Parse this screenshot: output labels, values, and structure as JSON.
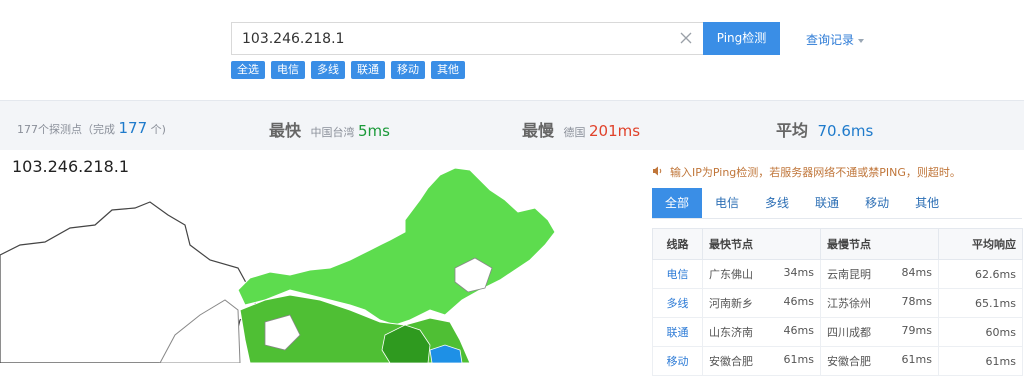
{
  "search": {
    "value": "103.246.218.1",
    "button_label": "Ping检测",
    "history_label": "查询记录"
  },
  "filters": [
    "全选",
    "电信",
    "多线",
    "联通",
    "移动",
    "其他"
  ],
  "stats": {
    "nodes_prefix": "177个探测点（完成",
    "nodes_done": "177",
    "nodes_suffix": "个)",
    "fastest_label": "最快",
    "fastest_location": "中国台湾",
    "fastest_value": "5ms",
    "slowest_label": "最慢",
    "slowest_location": "德国",
    "slowest_value": "201ms",
    "average_label": "平均",
    "average_value": "70.6ms"
  },
  "map": {
    "ip_title": "103.246.218.1",
    "colors": {
      "fast": "#5ddc4e",
      "medium": "#4fbf34",
      "dark": "#2f9a1f",
      "sea": "#1e90e6",
      "border": "#444444"
    }
  },
  "panel": {
    "notice": "输入IP为Ping检测，若服务器网络不通或禁PING，则超时。",
    "tabs": [
      "全部",
      "电信",
      "多线",
      "联通",
      "移动",
      "其他"
    ],
    "table": {
      "headers": {
        "line": "线路",
        "fastest": "最快节点",
        "slowest": "最慢节点",
        "average": "平均响应"
      },
      "rows": [
        {
          "line": "电信",
          "fast_node": "广东佛山",
          "fast_ms": "34ms",
          "slow_node": "云南昆明",
          "slow_ms": "84ms",
          "avg": "62.6ms"
        },
        {
          "line": "多线",
          "fast_node": "河南新乡",
          "fast_ms": "46ms",
          "slow_node": "江苏徐州",
          "slow_ms": "78ms",
          "avg": "65.1ms"
        },
        {
          "line": "联通",
          "fast_node": "山东济南",
          "fast_ms": "46ms",
          "slow_node": "四川成都",
          "slow_ms": "79ms",
          "avg": "60ms"
        },
        {
          "line": "移动",
          "fast_node": "安徽合肥",
          "fast_ms": "61ms",
          "slow_node": "安徽合肥",
          "slow_ms": "61ms",
          "avg": "61ms"
        }
      ]
    }
  }
}
